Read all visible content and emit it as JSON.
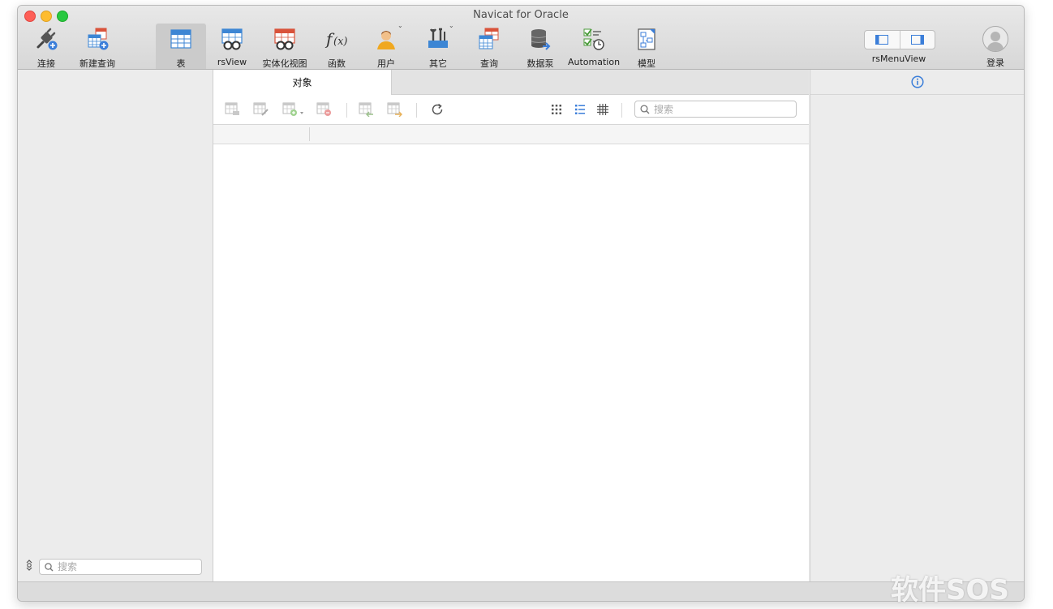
{
  "window": {
    "title": "Navicat for Oracle"
  },
  "toolbar": {
    "items": [
      {
        "label": "连接",
        "icon": "plug-icon"
      },
      {
        "label": "新建查询",
        "icon": "new-query-icon"
      },
      {
        "label": "表",
        "icon": "table-icon"
      },
      {
        "label": "rsView",
        "icon": "view-icon"
      },
      {
        "label": "实体化视图",
        "icon": "materialized-view-icon"
      },
      {
        "label": "函数",
        "icon": "function-icon"
      },
      {
        "label": "用户",
        "icon": "user-icon"
      },
      {
        "label": "其它",
        "icon": "tools-icon"
      },
      {
        "label": "查询",
        "icon": "query-icon"
      },
      {
        "label": "数据泵",
        "icon": "data-pump-icon"
      },
      {
        "label": "Automation",
        "icon": "automation-icon"
      },
      {
        "label": "模型",
        "icon": "model-icon"
      }
    ],
    "view_toggle_label": "rsMenuView",
    "login_label": "登录"
  },
  "sidebar": {
    "search_placeholder": "搜索"
  },
  "main": {
    "tab_label": "对象",
    "search_placeholder": "搜索"
  },
  "watermark": "软件SOS",
  "colors": {
    "accent": "#3b7ed9",
    "table_blue": "#3d86d4",
    "view_red": "#d9533b"
  }
}
